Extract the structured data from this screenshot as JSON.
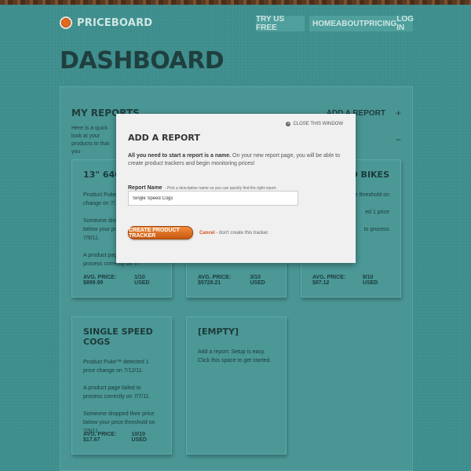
{
  "brand": {
    "name": "PRICEBOARD",
    "try_label": "TRY US FREE"
  },
  "nav": {
    "items": [
      "HOME",
      "ABOUT",
      "PRICING",
      "LOG IN"
    ]
  },
  "page": {
    "title": "DASHBOARD"
  },
  "reports": {
    "header": "MY REPORTS",
    "intro": "Here is a quick look at your products to that you",
    "add_report": "ADD A REPORT",
    "plus": "+",
    "minus": "−",
    "cards": [
      {
        "title": "13\" 64GB M",
        "lines": [
          "Product Puke™ detected price change on 7/1",
          "Someone dropped their price below your price threshold on 7/9/11.",
          "A product page failed to process correctly on 7/"
        ],
        "avg": "AVG. PRICE: $899.99",
        "used": "1/10 USED"
      },
      {
        "title": "",
        "lines": [],
        "avg": "AVG. PRICE: $5728.21",
        "used": "3/10 USED"
      },
      {
        "title": "D BIKES",
        "lines": [
          "their price threshold on",
          "ed 1 price",
          "to process"
        ],
        "avg": "AVG. PRICE: $87.12",
        "used": "9/10 USED"
      },
      {
        "title": "SINGLE SPEED COGS",
        "lines": [
          "Product Puke™ detected 1 price change on 7/12/11.",
          "A product page failed to process correctly on 7/7/11.",
          "Someone dropped their price below your price threshold on 7/9/11."
        ],
        "avg": "AVG. PRICE: $17.67",
        "used": "10/10 USED"
      },
      {
        "title": "[EMPTY]",
        "lines": [
          "Add a report: Setup is easy. Click this space to get started."
        ],
        "avg": "",
        "used": ""
      }
    ]
  },
  "modal": {
    "title": "ADD A REPORT",
    "close_label": "CLOSE THIS WINDOW",
    "desc_strong": "All you need to start a report is a name.",
    "desc_rest": " On your new report page, you will be able to create product trackers and begin monitoring prices!",
    "field_label": "Report Name",
    "field_hint": " - Pick a descriptive name so you can quickly find the right report.",
    "input_value": "Single Speed Cogs",
    "create_label": "CREATE PRODUCT TRACKER",
    "cancel_label": "Cancel",
    "cancel_rest": " - don't create this tracker."
  }
}
